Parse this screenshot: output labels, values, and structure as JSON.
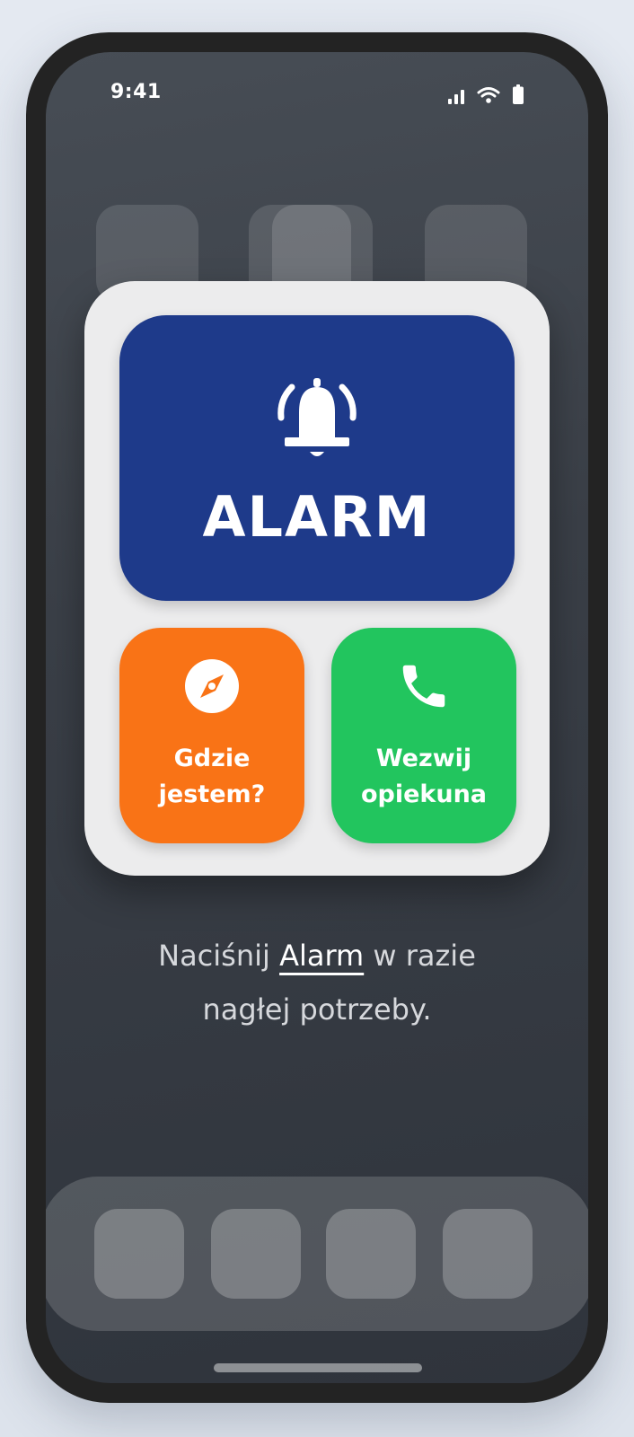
{
  "status_bar": {
    "time": "9:41",
    "icons": [
      "signal-icon",
      "wifi-icon",
      "battery-icon"
    ]
  },
  "alarm": {
    "label": "ALARM",
    "icon": "bell-ringing-icon",
    "color": "#1e3a8a"
  },
  "tiles": [
    {
      "line1": "Gdzie",
      "line2": "jestem?",
      "icon": "compass-icon",
      "color": "#f97316"
    },
    {
      "line1": "Wezwij",
      "line2": "opiekuna",
      "icon": "phone-icon",
      "color": "#22c55e"
    }
  ],
  "hint": {
    "before": "Naciśnij ",
    "highlight": "Alarm",
    "after_line1": " w razie",
    "line2": "nagłej potrzeby."
  },
  "colors": {
    "widget_bg": "#ececed",
    "screen_bg": "#3a3f47"
  }
}
